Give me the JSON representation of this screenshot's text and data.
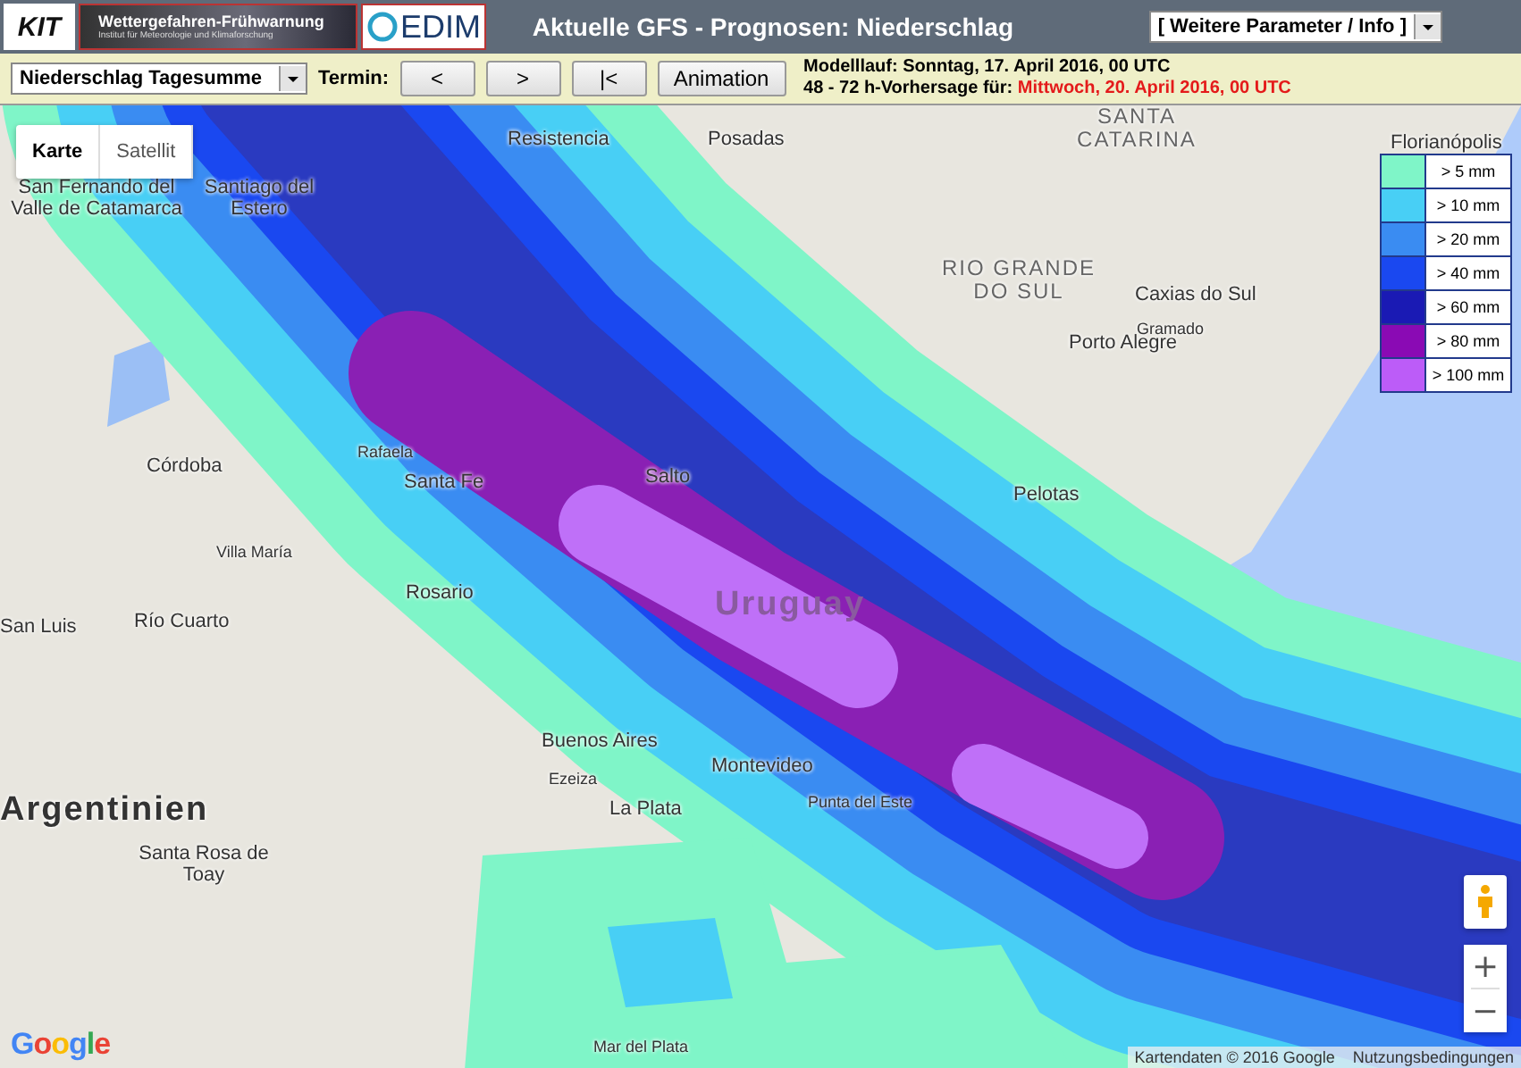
{
  "header": {
    "logo_text": "KIT",
    "banner_title": "Wettergefahren-Frühwarnung",
    "banner_subtitle": "Institut für Meteorologie und Klimaforschung",
    "edim_text": "EDIM",
    "title": "Aktuelle GFS - Prognosen: Niederschlag",
    "menu": "[ Weitere Parameter / Info ]"
  },
  "toolbar": {
    "parameter": "Niederschlag Tagesumme",
    "termin_label": "Termin:",
    "buttons": [
      "<",
      ">",
      "|<",
      "Animation"
    ],
    "model_run": "Modelllauf: Sonntag, 17. April 2016, 00 UTC",
    "forecast_label": "48 - 72 h-Vorhersage für:",
    "forecast_date": "Mittwoch, 20. April 2016, 00 UTC"
  },
  "map": {
    "tabs": [
      {
        "label": "Karte",
        "selected": true
      },
      {
        "label": "Satellit",
        "selected": false
      }
    ],
    "legend": [
      {
        "label": "> 5 mm",
        "color": "#7ff5c8"
      },
      {
        "label": "> 10 mm",
        "color": "#48cff5"
      },
      {
        "label": "> 20 mm",
        "color": "#3a8cf2"
      },
      {
        "label": "> 40 mm",
        "color": "#1a48f0"
      },
      {
        "label": "> 60 mm",
        "color": "#1a1ab4"
      },
      {
        "label": "> 80 mm",
        "color": "#8a0ab4"
      },
      {
        "label": "> 100 mm",
        "color": "#bc5cf8"
      }
    ],
    "labels": [
      {
        "text": "Resistencia",
        "kind": "city"
      },
      {
        "text": "Posadas",
        "kind": "city"
      },
      {
        "text": "SANTA CATARINA",
        "kind": "region"
      },
      {
        "text": "Florianópolis",
        "kind": "city"
      },
      {
        "text": "San Fernando del Valle de Catamarca",
        "kind": "city"
      },
      {
        "text": "Santiago del Estero",
        "kind": "city"
      },
      {
        "text": "RIO GRANDE DO SUL",
        "kind": "region"
      },
      {
        "text": "Caxias do Sul",
        "kind": "city"
      },
      {
        "text": "Gramado",
        "kind": "town"
      },
      {
        "text": "Porto Alegre",
        "kind": "city"
      },
      {
        "text": "Córdoba",
        "kind": "city"
      },
      {
        "text": "Rafaela",
        "kind": "town"
      },
      {
        "text": "Santa Fe",
        "kind": "city"
      },
      {
        "text": "Salto",
        "kind": "city"
      },
      {
        "text": "Pelotas",
        "kind": "city"
      },
      {
        "text": "Villa María",
        "kind": "town"
      },
      {
        "text": "Rosario",
        "kind": "city"
      },
      {
        "text": "Uruguay",
        "kind": "country"
      },
      {
        "text": "San Luis",
        "kind": "city"
      },
      {
        "text": "Río Cuarto",
        "kind": "city"
      },
      {
        "text": "Buenos Aires",
        "kind": "city"
      },
      {
        "text": "Ezeiza",
        "kind": "town"
      },
      {
        "text": "Montevideo",
        "kind": "city"
      },
      {
        "text": "Argentinien",
        "kind": "country"
      },
      {
        "text": "La Plata",
        "kind": "city"
      },
      {
        "text": "Punta del Este",
        "kind": "town"
      },
      {
        "text": "Santa Rosa de Toay",
        "kind": "city"
      },
      {
        "text": "Mar del Plata",
        "kind": "town"
      }
    ],
    "zoom_in": "+",
    "zoom_out": "−",
    "google": "Google",
    "attribution": "Kartendaten © 2016 Google",
    "terms": "Nutzungsbedingungen"
  }
}
